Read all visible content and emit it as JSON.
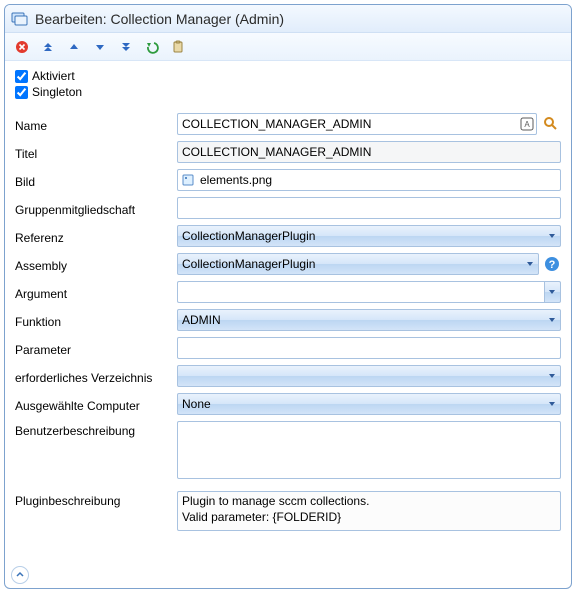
{
  "header": {
    "title": "Bearbeiten: Collection Manager (Admin)"
  },
  "checks": {
    "activated": {
      "label": "Aktiviert",
      "checked": true
    },
    "singleton": {
      "label": "Singleton",
      "checked": true
    }
  },
  "labels": {
    "name": "Name",
    "title": "Titel",
    "image": "Bild",
    "group": "Gruppenmitgliedschaft",
    "reference": "Referenz",
    "assembly": "Assembly",
    "argument": "Argument",
    "function": "Funktion",
    "parameter": "Parameter",
    "reqdir": "erforderliches Verzeichnis",
    "selcomp": "Ausgewählte Computer",
    "userdesc": "Benutzerbeschreibung",
    "plugdesc": "Pluginbeschreibung"
  },
  "values": {
    "name": "COLLECTION_MANAGER_ADMIN",
    "title": "COLLECTION_MANAGER_ADMIN",
    "image": "elements.png",
    "group": "",
    "reference": "CollectionManagerPlugin",
    "assembly": "CollectionManagerPlugin",
    "argument": "",
    "function": "ADMIN",
    "parameter": "",
    "reqdir": "",
    "selcomp": "None",
    "userdesc": "",
    "plugdesc": "Plugin to manage sccm collections.\nValid parameter: {FOLDERID}"
  }
}
